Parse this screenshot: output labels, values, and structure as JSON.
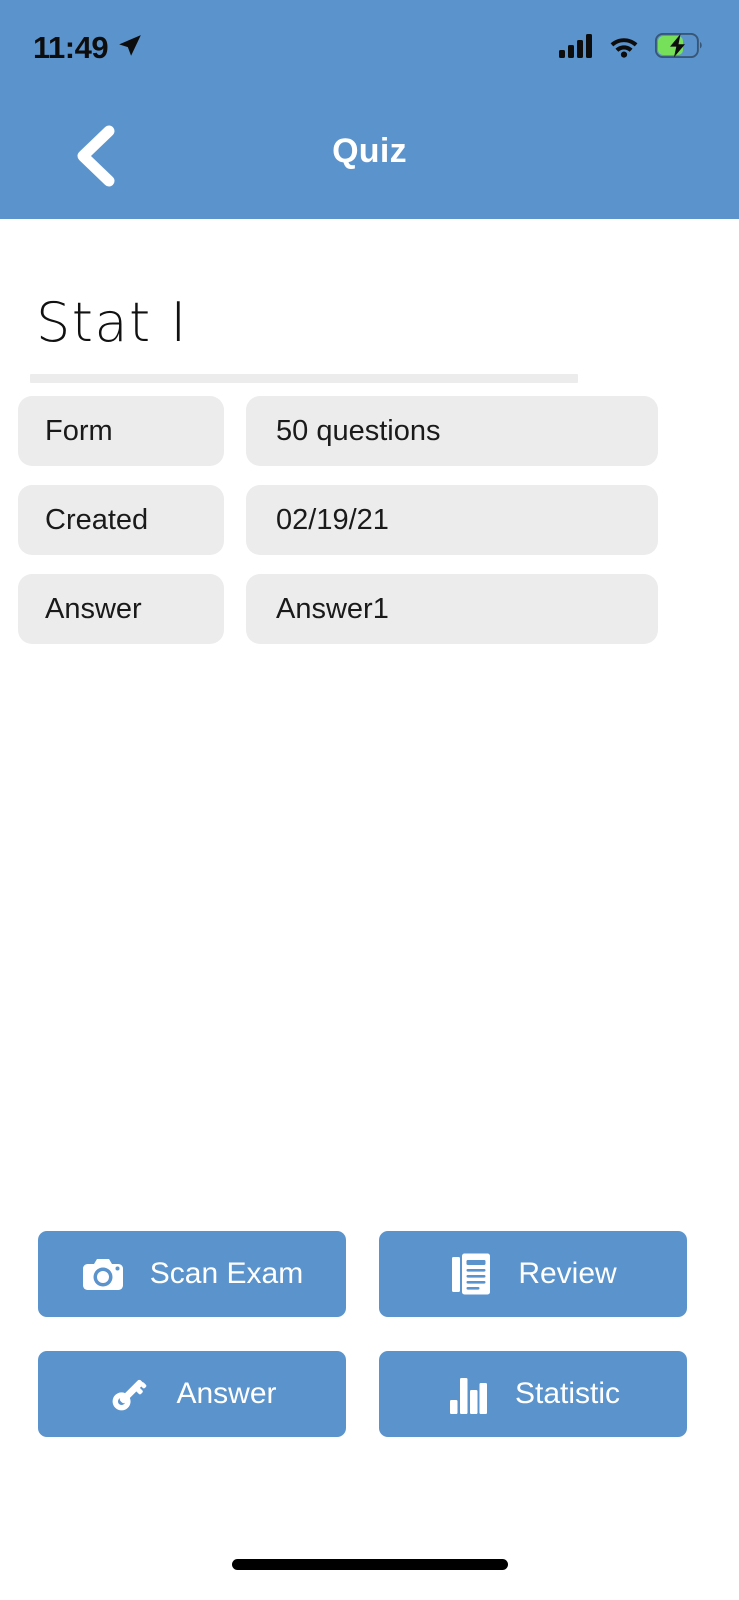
{
  "status_bar": {
    "time": "11:49",
    "location_icon": "location-arrow-icon",
    "signal_icon": "cellular-signal-icon",
    "wifi_icon": "wifi-icon",
    "battery_icon": "battery-charging-icon",
    "battery_level_pct": 60,
    "battery_fill_color": "#76e05a",
    "icon_color": "#0d0d0d"
  },
  "header": {
    "title": "Quiz",
    "back_icon": "chevron-left-icon",
    "background": "#5b93cc",
    "title_color": "#ffffff"
  },
  "quiz": {
    "name": "Stat I",
    "info_rows": [
      {
        "key": "Form",
        "value": "50 questions"
      },
      {
        "key": "Created",
        "value": "02/19/21"
      },
      {
        "key": "Answer",
        "value": "Answer1"
      }
    ],
    "row_bg": "#ececec"
  },
  "actions": {
    "accent_color": "#5b93cc",
    "buttons": [
      {
        "label": "Scan Exam",
        "icon": "camera-icon"
      },
      {
        "label": "Review",
        "icon": "document-lines-icon"
      },
      {
        "label": "Answer",
        "icon": "key-icon"
      },
      {
        "label": "Statistic",
        "icon": "bar-chart-icon"
      }
    ]
  },
  "system": {
    "home_indicator": "home-indicator-bar"
  }
}
